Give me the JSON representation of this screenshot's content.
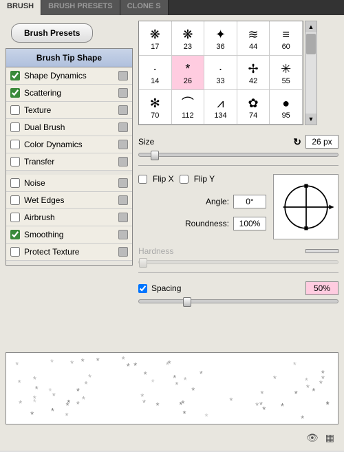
{
  "tabs": [
    "BRUSH",
    "BRUSH PRESETS",
    "CLONE S"
  ],
  "brush_presets_btn": "Brush Presets",
  "sidebar": {
    "header": "Brush Tip Shape",
    "items": [
      {
        "label": "Shape Dynamics",
        "checked": true,
        "lock": true
      },
      {
        "label": "Scattering",
        "checked": true,
        "lock": true
      },
      {
        "label": "Texture",
        "checked": false,
        "lock": true
      },
      {
        "label": "Dual Brush",
        "checked": false,
        "lock": true
      },
      {
        "label": "Color Dynamics",
        "checked": false,
        "lock": true
      },
      {
        "label": "Transfer",
        "checked": false,
        "lock": true
      },
      {
        "label": "Noise",
        "checked": false,
        "lock": true
      },
      {
        "label": "Wet Edges",
        "checked": false,
        "lock": true
      },
      {
        "label": "Airbrush",
        "checked": false,
        "lock": true
      },
      {
        "label": "Smoothing",
        "checked": true,
        "lock": true
      },
      {
        "label": "Protect Texture",
        "checked": false,
        "lock": true
      }
    ]
  },
  "swatches": [
    {
      "size": "17",
      "g": "❋"
    },
    {
      "size": "23",
      "g": "❋"
    },
    {
      "size": "36",
      "g": "✦"
    },
    {
      "size": "44",
      "g": "≋"
    },
    {
      "size": "60",
      "g": "≡"
    },
    {
      "size": "14",
      "g": "·"
    },
    {
      "size": "26",
      "g": "*",
      "sel": true
    },
    {
      "size": "33",
      "g": "·"
    },
    {
      "size": "42",
      "g": "✢"
    },
    {
      "size": "55",
      "g": "✳"
    },
    {
      "size": "70",
      "g": "✻"
    },
    {
      "size": "112",
      "g": "⌒"
    },
    {
      "size": "134",
      "g": "⩘"
    },
    {
      "size": "74",
      "g": "✿"
    },
    {
      "size": "95",
      "g": "●"
    }
  ],
  "size": {
    "label": "Size",
    "value": "26 px"
  },
  "flip": {
    "x": "Flip X",
    "y": "Flip Y",
    "xc": false,
    "yc": false
  },
  "angle": {
    "label": "Angle:",
    "value": "0°"
  },
  "roundness": {
    "label": "Roundness:",
    "value": "100%"
  },
  "hardness": {
    "label": "Hardness"
  },
  "spacing": {
    "label": "Spacing",
    "checked": true,
    "value": "50%"
  },
  "reset_icon": "↻"
}
